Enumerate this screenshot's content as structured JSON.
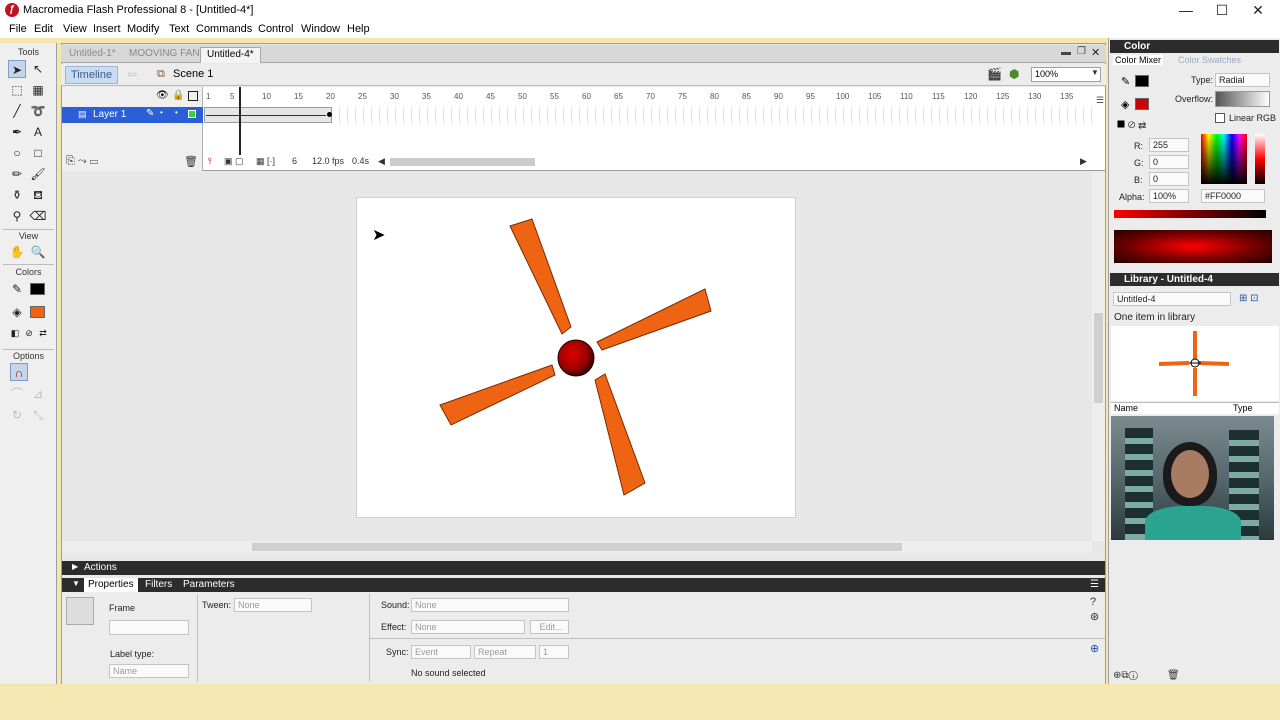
{
  "window": {
    "title": "Macromedia Flash Professional 8 - [Untitled-4*]",
    "minimize": "—",
    "maximize": "☐",
    "close": "✕"
  },
  "menu": [
    "File",
    "Edit",
    "View",
    "Insert",
    "Modify",
    "Text",
    "Commands",
    "Control",
    "Window",
    "Help"
  ],
  "tools": {
    "header": "Tools",
    "view_header": "View",
    "colors_header": "Colors",
    "options_header": "Options"
  },
  "doc_tabs": [
    "Untitled-1*",
    "MOOVING FAN*",
    "Untitled-4*"
  ],
  "editbar": {
    "timeline_label": "Timeline",
    "scene_label": "Scene 1",
    "zoom": "100%"
  },
  "timeline": {
    "layer_name": "Layer 1",
    "frame_numbers": [
      "1",
      "5",
      "10",
      "15",
      "20",
      "25",
      "30",
      "35",
      "40",
      "45",
      "50",
      "55",
      "60",
      "65",
      "70",
      "75",
      "80",
      "85",
      "90",
      "95",
      "100",
      "105",
      "110",
      "115",
      "120",
      "125",
      "130",
      "135"
    ],
    "current_frame": "6",
    "fps": "12.0 fps",
    "time": "0.4s"
  },
  "stage": {
    "background": "#ffffff",
    "blade_color": "#ef6412",
    "hub_color": "#cc0000"
  },
  "actions_label": "Actions",
  "properties": {
    "tabs": [
      "Properties",
      "Filters",
      "Parameters"
    ],
    "frame_label": "Frame",
    "tween_label": "Tween:",
    "tween_value": "None",
    "sound_label": "Sound:",
    "sound_value": "None",
    "effect_label": "Effect:",
    "effect_value": "None",
    "edit_button": "Edit...",
    "sync_label": "Sync:",
    "sync_value": "Event",
    "repeat_value": "Repeat",
    "repeat_count": "1",
    "label_type_label": "Label type:",
    "label_type_value": "Name",
    "no_sound": "No sound selected"
  },
  "color_panel": {
    "header": "Color",
    "tab_mixer": "Color Mixer",
    "tab_swatches": "Color Swatches",
    "type_label": "Type:",
    "type_value": "Radial",
    "overflow_label": "Overflow:",
    "linear_rgb": "Linear RGB",
    "r_label": "R:",
    "r_value": "255",
    "g_label": "G:",
    "g_value": "0",
    "b_label": "B:",
    "b_value": "0",
    "alpha_label": "Alpha:",
    "alpha_value": "100%",
    "hex_value": "#FF0000"
  },
  "library_panel": {
    "header": "Library - Untitled-4",
    "doc_select": "Untitled-4",
    "count_text": "One item in library",
    "col_name": "Name",
    "col_type": "Type"
  }
}
